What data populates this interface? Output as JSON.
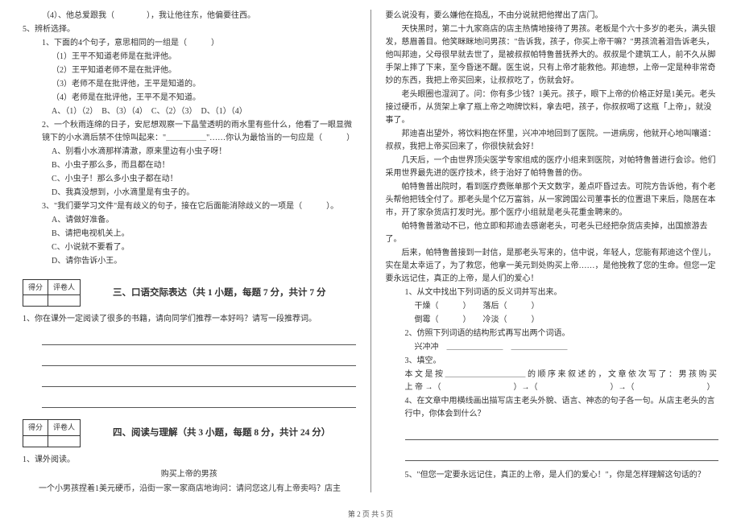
{
  "left": {
    "q5_4": "（4）、他总爱跟我（　　　　），我让他往东，他偏要往西。",
    "q5_title": "5、辨析选择。",
    "q5_1": "1、下面的4个句子，意思相同的一组是（　　　）",
    "q5_1_opts": [
      "（1）王平不知道老师是在批评他。",
      "（2）王平知道老师不是在批评他。",
      "（3）老师不是在批评他，王平是知道的。",
      "（4）老师是在批评他，王平不是不知道。"
    ],
    "q5_1_choices": "A、（1）（2）　B、（3）（4）　C、（2）（3）　D、（1）（4）",
    "q5_2_intro": "2、一个秋雨连绵的日子，安尼想观察一下晶莹透明的雨水里有些什么，他看了一眼显微镜下的小水滴后禁不住惊叫起来：\"＿＿＿＿＿\"……你认为最恰当的一句应是（　　　）",
    "q5_2_opts": [
      "A、别看小水滴那样清澈，原来里边有小虫子呀！",
      "B、小虫子那么多，而且都在动！",
      "C、小虫子！那么多小虫子都在动！",
      "D、我真没想到，小水滴里是有虫子的。"
    ],
    "q5_3": "3、\"我们要学习文件\"是有歧义的句子，接在它后面能消除歧义的一项是（　　　）。",
    "q5_3_opts": [
      "A、请做好准备。",
      "B、请把电视机关上。",
      "C、小说就不要看了。",
      "D、请你告诉小王。"
    ],
    "score_hdr1": "得分",
    "score_hdr2": "评卷人",
    "section3": "三、口语交际表达（共 1 小题，每题 7 分，共计 7 分",
    "s3_q1": "1、你在课外一定阅读了很多的书籍，请向同学们推荐一本好吗？请写一段推荐词。",
    "section4": "四、阅读与理解（共 3 小题，每题 8 分，共计 24 分）",
    "s4_q1": "1、课外阅读。",
    "passage_title": "购买上帝的男孩",
    "passage_p1": "一个小男孩捏着1美元硬币，沿街一家一家商店地询问：请问您这儿有上帝卖吗？店主"
  },
  "right": {
    "passage": [
      "要么说没有，要么嫌他在捣乱，不由分说就把他撵出了店门。",
      "天快黑时，第二十九家商店的店主热情地接待了男孩。老板是个六十多岁的老头，满头银发，慈眉善目。他笑眯眯地问男孩：\"告诉我，孩子，你买上帝干嘛？\"男孩流着泪告诉老头，他叫邦迪，父母很早就去世了，是被叔叔帕特鲁普抚养大的。叔叔是个建筑工人，前不久从脚手架上摔了下来，至今昏迷不醒。医生说，只有上帝才能救他。邦迪想，上帝一定是种非常奇妙的东西，我把上帝买回来，让叔叔吃了，伤就会好。",
      "老头眼圈也湿润了。问：你有多少钱？1美元。孩子，眼下上帝的价格正好是1美元。老头接过硬币，从货架上拿了瓶上帝之吻牌饮料，拿去吧，孩子，你叔叔喝了这瓶「上帝」，就没事了。",
      "邦迪喜出望外，将饮料抱在怀里，兴冲冲地回到了医院。一进病房，他就开心地叫嚷道：叔叔，我把上帝买回来了，你很快就会好！",
      "几天后，一个由世界顶尖医学专家组成的医疗小组来到医院，对帕特鲁普进行会诊。他们采用世界最先进的医疗技术，终于治好了帕特鲁普的伤。",
      "帕特鲁普出院时，看到医疗费账单那个天文数字，差点吓昏过去。可院方告诉他，有个老头帮他把钱全付了。那老头是个亿万富翁，从一家跨国公司董事长的位置退下来后，隐居在本市，开了家杂货店打发时光。那个医疗小组就是老头花重金聘来的。",
      "帕特鲁普激动不已，他立即和邦迪去感谢老头，可老头已经把杂货店卖掉，出国旅游去了。",
      "后来，帕特鲁普接到一封信，是那老头写来的，信中说，年轻人，您能有邦迪这个侄儿，实在是太幸运了，为了救您，他拿一美元到处购买上帝……，是他挽救了您的生命。但您一定要永远记住，真正的上帝，是人们的爱心！"
    ],
    "q1": "1、从文中找出下列词语的反义词并写出来。",
    "q1_items": [
      "干燥（　　　）　　落后（　　　）",
      "倒霉（　　　）　　冷淡（　　　）"
    ],
    "q2": "2、仿照下列词语的结构形式再写出两个词语。",
    "q2_item": "兴冲冲　＿＿＿＿＿＿＿　＿＿＿＿＿＿＿",
    "q3": "3、填空。",
    "q3_body": "本 文 是 按 ＿＿＿＿＿＿＿＿＿＿ 的 顺 序 来 叙 述 的 ， 文 章 依 次 写 了 ： 男 孩 购 买 上 帝 →（　　　　　　　　　）→（　　　　　　　　　）→（　　　　　　　　　）",
    "q4": "4、在文章中用横线画出描写店主老头外貌、语言、神态的句子各一句。从店主老头的言行中，你体会到什么？",
    "q5": "5、\"但您一定要永远记住，真正的上帝，是人们的爱心！\"，你是怎样理解这句话的？"
  },
  "footer": "第 2 页 共 5 页"
}
